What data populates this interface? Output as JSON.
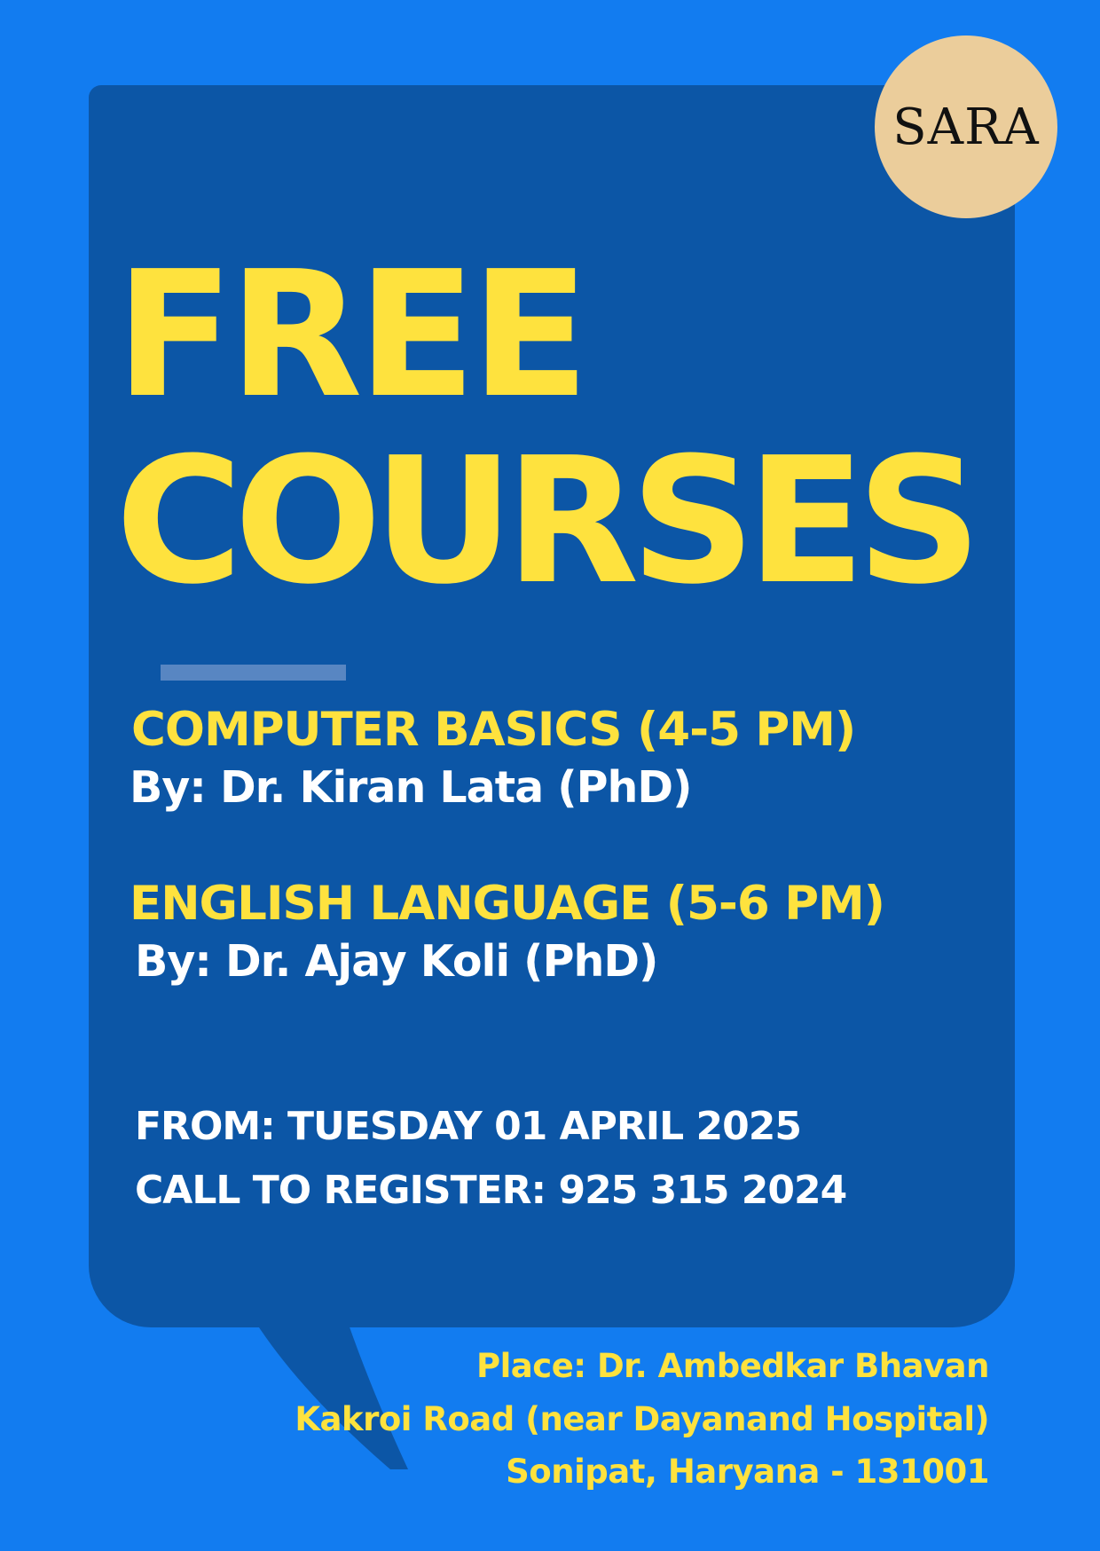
{
  "logo": {
    "text": "SARA"
  },
  "headline": {
    "line1": "FREE",
    "line2": "COURSES"
  },
  "courses": [
    {
      "title": "COMPUTER BASICS (4-5 PM)",
      "instructor": "By: Dr. Kiran Lata (PhD)"
    },
    {
      "title": "ENGLISH LANGUAGE (5-6 PM)",
      "instructor": "By: Dr. Ajay Koli (PhD)"
    }
  ],
  "details": {
    "start": "FROM: TUESDAY 01 APRIL 2025",
    "register": "CALL TO REGISTER: 925 315 2024"
  },
  "place": {
    "line1": "Place: Dr. Ambedkar Bhavan",
    "line2": "Kakroi Road (near Dayanand Hospital)",
    "line3": "Sonipat, Haryana - 131001"
  },
  "colors": {
    "background": "#127cf0",
    "bubble": "#0c56a6",
    "accent_yellow": "#fee23e",
    "logo_circle": "#ebcd9b",
    "text_white": "#ffffff"
  }
}
